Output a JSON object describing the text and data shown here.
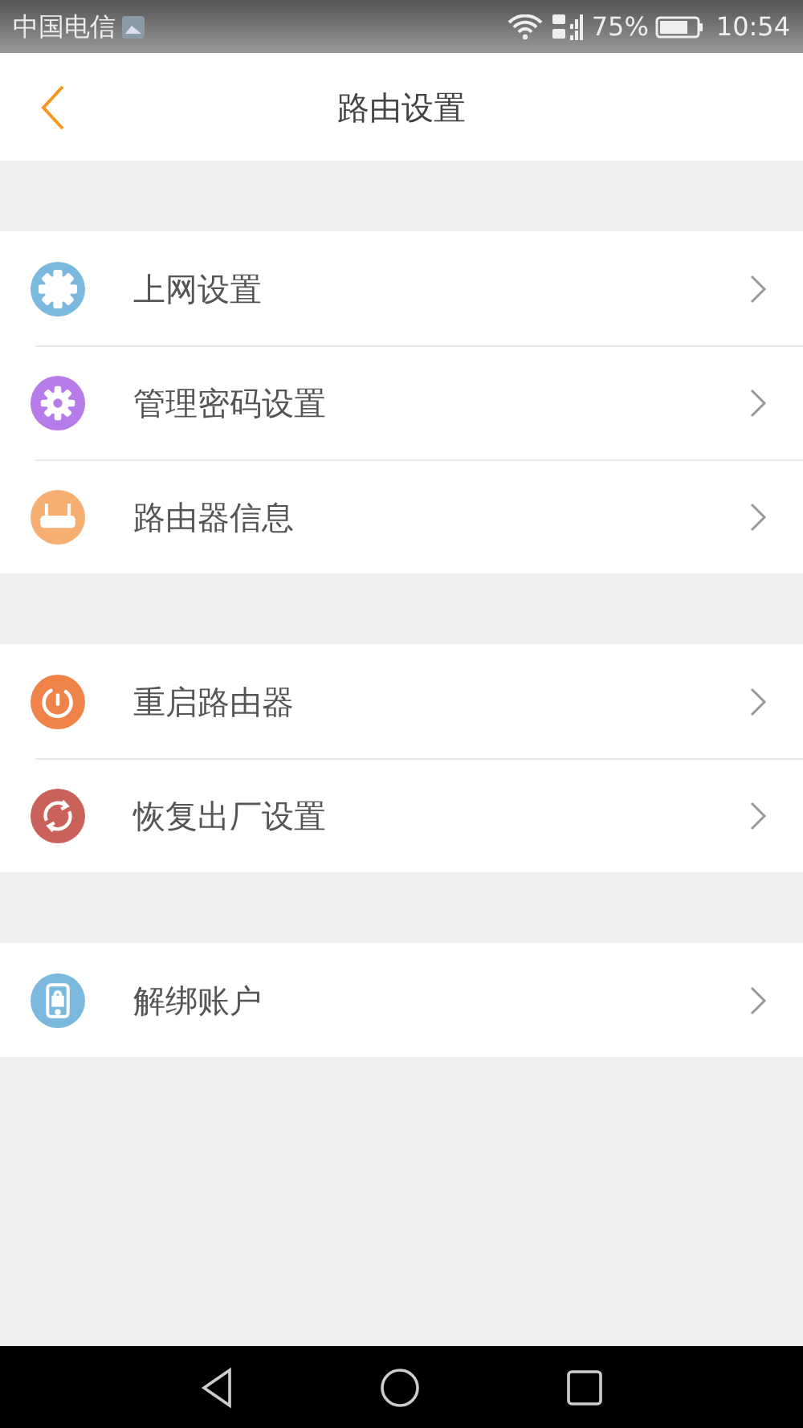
{
  "status_bar": {
    "carrier": "中国电信",
    "battery": "75%",
    "time": "10:54"
  },
  "header": {
    "title": "路由设置"
  },
  "groups": [
    {
      "items": [
        {
          "label": "上网设置",
          "kind": "gear",
          "color": "#7ab8de"
        },
        {
          "label": "管理密码设置",
          "kind": "password",
          "color": "#b57be8"
        },
        {
          "label": "路由器信息",
          "kind": "router",
          "color": "#f7ae72"
        }
      ]
    },
    {
      "items": [
        {
          "label": "重启路由器",
          "kind": "power",
          "color": "#f0834a"
        },
        {
          "label": "恢复出厂设置",
          "kind": "reset",
          "color": "#c8625a"
        }
      ]
    },
    {
      "items": [
        {
          "label": "解绑账户",
          "kind": "unbind",
          "color": "#7ab8de"
        }
      ]
    }
  ]
}
